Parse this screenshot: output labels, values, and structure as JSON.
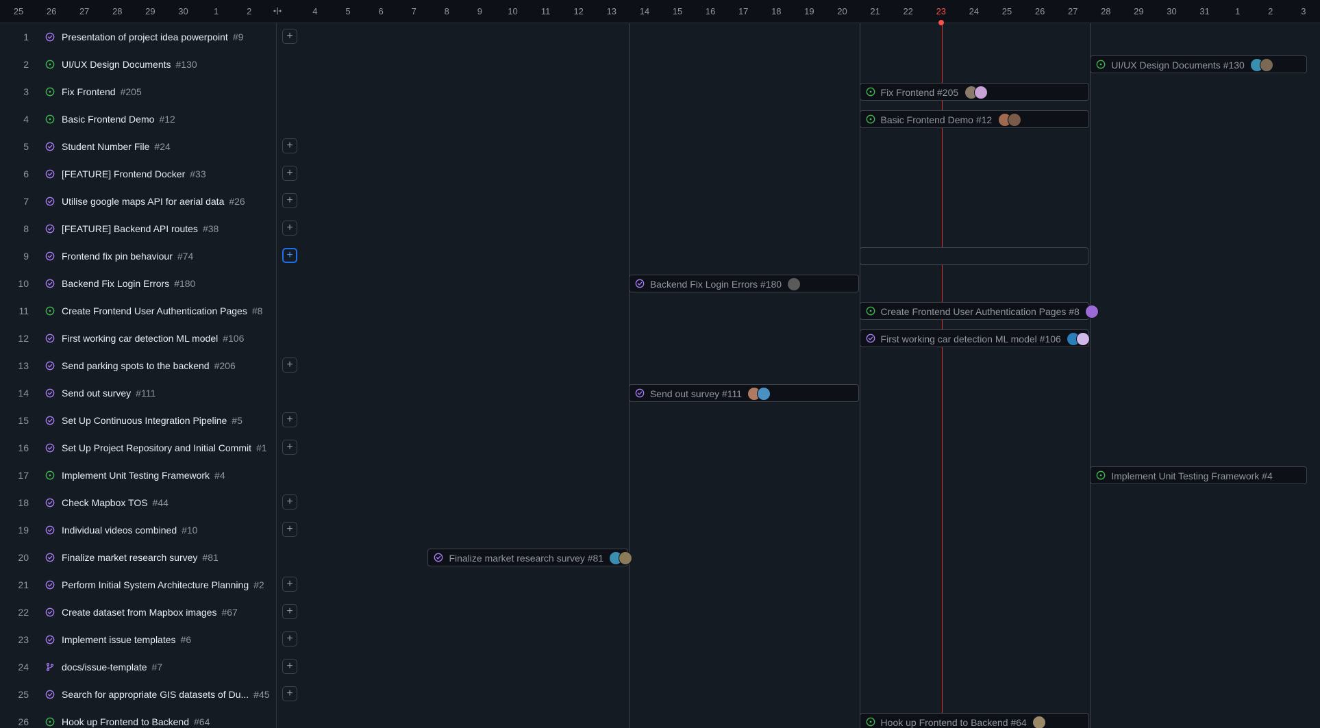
{
  "timeline": {
    "days": [
      "25",
      "26",
      "27",
      "28",
      "29",
      "30",
      "1",
      "2",
      "3",
      "4",
      "5",
      "6",
      "7",
      "8",
      "9",
      "10",
      "11",
      "12",
      "13",
      "14",
      "15",
      "16",
      "17",
      "18",
      "19",
      "20",
      "21",
      "22",
      "23",
      "24",
      "25",
      "26",
      "27",
      "28",
      "29",
      "30",
      "31",
      "1",
      "2",
      "3"
    ],
    "today_label": "23",
    "resize_icon": "column-resize-icon"
  },
  "colors": {
    "open": "#3fb950",
    "closed": "#ab7df8",
    "today": "#f85149"
  },
  "rows": [
    {
      "n": "1",
      "title": "Presentation of project idea powerpoint",
      "num": "#9",
      "state": "closed"
    },
    {
      "n": "2",
      "title": "UI/UX Design Documents",
      "num": "#130",
      "state": "open"
    },
    {
      "n": "3",
      "title": "Fix Frontend",
      "num": "#205",
      "state": "open"
    },
    {
      "n": "4",
      "title": "Basic Frontend Demo",
      "num": "#12",
      "state": "open"
    },
    {
      "n": "5",
      "title": "Student Number File",
      "num": "#24",
      "state": "closed"
    },
    {
      "n": "6",
      "title": "[FEATURE] Frontend Docker",
      "num": "#33",
      "state": "closed"
    },
    {
      "n": "7",
      "title": "Utilise google maps API for aerial data",
      "num": "#26",
      "state": "closed"
    },
    {
      "n": "8",
      "title": "[FEATURE] Backend API routes",
      "num": "#38",
      "state": "closed"
    },
    {
      "n": "9",
      "title": "Frontend fix pin behaviour",
      "num": "#74",
      "state": "closed"
    },
    {
      "n": "10",
      "title": "Backend Fix Login Errors",
      "num": "#180",
      "state": "closed"
    },
    {
      "n": "11",
      "title": "Create Frontend User Authentication Pages",
      "num": "#8",
      "state": "open"
    },
    {
      "n": "12",
      "title": "First working car detection ML model",
      "num": "#106",
      "state": "closed"
    },
    {
      "n": "13",
      "title": "Send parking spots to the backend",
      "num": "#206",
      "state": "closed"
    },
    {
      "n": "14",
      "title": "Send out survey",
      "num": "#111",
      "state": "closed"
    },
    {
      "n": "15",
      "title": "Set Up Continuous Integration Pipeline",
      "num": "#5",
      "state": "closed"
    },
    {
      "n": "16",
      "title": "Set Up Project Repository and Initial Commit",
      "num": "#1",
      "state": "closed"
    },
    {
      "n": "17",
      "title": "Implement Unit Testing Framework",
      "num": "#4",
      "state": "open"
    },
    {
      "n": "18",
      "title": "Check Mapbox TOS",
      "num": "#44",
      "state": "closed"
    },
    {
      "n": "19",
      "title": "Individual videos combined",
      "num": "#10",
      "state": "closed"
    },
    {
      "n": "20",
      "title": "Finalize market research survey",
      "num": "#81",
      "state": "closed"
    },
    {
      "n": "21",
      "title": "Perform Initial System Architecture Planning",
      "num": "#2",
      "state": "closed"
    },
    {
      "n": "22",
      "title": "Create dataset from Mapbox images",
      "num": "#67",
      "state": "closed"
    },
    {
      "n": "23",
      "title": "Implement issue templates",
      "num": "#6",
      "state": "closed"
    },
    {
      "n": "24",
      "title": "docs/issue-template",
      "num": "#7",
      "state": "branch"
    },
    {
      "n": "25",
      "title": "Search for appropriate GIS datasets of Du...",
      "num": "#45",
      "state": "closed"
    },
    {
      "n": "26",
      "title": "Hook up Frontend to Backend",
      "num": "#64",
      "state": "open"
    }
  ],
  "bars": [
    {
      "row": 2,
      "label": "UI/UX Design Documents #130",
      "state": "open",
      "avatars": [
        "#3a8fb0",
        "#7a6a55"
      ]
    },
    {
      "row": 3,
      "label": "Fix Frontend #205",
      "state": "open",
      "avatars": [
        "#8a7a6a",
        "#c9a2d8"
      ]
    },
    {
      "row": 4,
      "label": "Basic Frontend Demo #12",
      "state": "open",
      "avatars": [
        "#a06a50",
        "#7a5a48"
      ]
    },
    {
      "row": 10,
      "label": "Backend Fix Login Errors #180",
      "state": "closed",
      "avatars": [
        "#5a5a5a"
      ]
    },
    {
      "row": 11,
      "label": "Create Frontend User Authentication Pages #8",
      "state": "open",
      "avatars": [
        "#9b6ad6"
      ]
    },
    {
      "row": 12,
      "label": "First working car detection ML model #106",
      "state": "closed",
      "avatars": [
        "#2a7fb8",
        "#d0b8e8"
      ]
    },
    {
      "row": 14,
      "label": "Send out survey #111",
      "state": "closed",
      "avatars": [
        "#b07a60",
        "#4a90c0"
      ]
    },
    {
      "row": 17,
      "label": "Implement Unit Testing Framework #4",
      "state": "open",
      "avatars": []
    },
    {
      "row": 20,
      "label": "Finalize market research survey #81",
      "state": "closed",
      "avatars": [
        "#3a8fb0",
        "#8a7a5a"
      ]
    },
    {
      "row": 26,
      "label": "Hook up Frontend to Backend #64",
      "state": "open",
      "avatars": [
        "#9a8a6a"
      ]
    }
  ],
  "add_buttons": {
    "label": "+",
    "rows": [
      1,
      5,
      6,
      7,
      8,
      9,
      13,
      15,
      16,
      18,
      19,
      21,
      22,
      23,
      24,
      25
    ],
    "focused_row": 9
  },
  "placeholder_row": 9
}
